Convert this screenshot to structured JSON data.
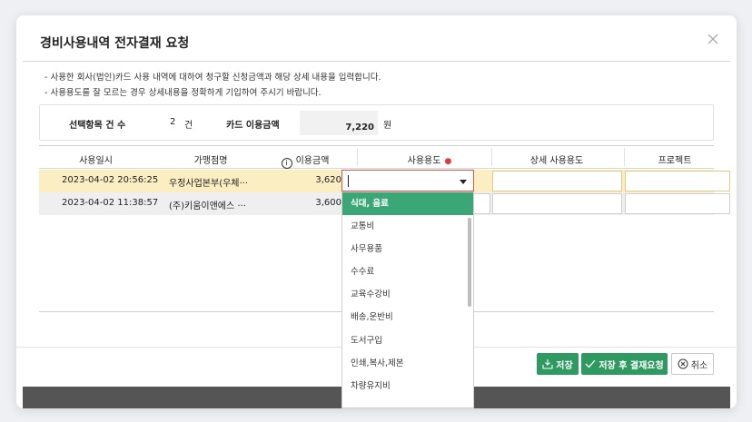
{
  "dialog": {
    "title": "경비사용내역 전자결재 요청",
    "notes": [
      "- 사용한 회사(법인)카드 사용 내역에 대하여 청구할 신청금액과 해당 상세 내용을 입력합니다.",
      "- 사용용도를 잘 모르는 경우 상세내용을 정확하게 기입하여 주시기 바랍니다."
    ]
  },
  "summary": {
    "selected_label": "선택항목 건 수",
    "selected_count": "2",
    "count_unit": "건",
    "card_amount_label": "카드 이용금액",
    "card_amount": "7,220",
    "amount_unit": "원"
  },
  "grid": {
    "headers": {
      "date": "사용일시",
      "merchant": "가맹점명",
      "amount": "이용금액",
      "usage": "사용용도",
      "detail": "상세 사용용도",
      "project": "프로젝트"
    },
    "rows": [
      {
        "date": "2023-04-02 20:56:25",
        "merchant": "우정사업본부(우체···",
        "amount": "3,620"
      },
      {
        "date": "2023-04-02 11:38:57",
        "merchant": "(주)키움이앤에스 ···",
        "amount": "3,600"
      }
    ]
  },
  "dropdown": {
    "options": [
      "식대, 음료",
      "교통비",
      "사무용품",
      "수수료",
      "교육수강비",
      "배송,운반비",
      "도서구입",
      "인쇄,복사,제본",
      "차량유지비"
    ],
    "highlighted": "식대, 음료"
  },
  "buttons": {
    "save": "저장",
    "save_and_pay": "저장 후 결재요청",
    "cancel": "취소"
  },
  "colors": {
    "accent_green": "#2e9a62",
    "selected_row": "#fbeec2",
    "dropdown_highlight": "#3ba776",
    "required": "#e53935"
  }
}
